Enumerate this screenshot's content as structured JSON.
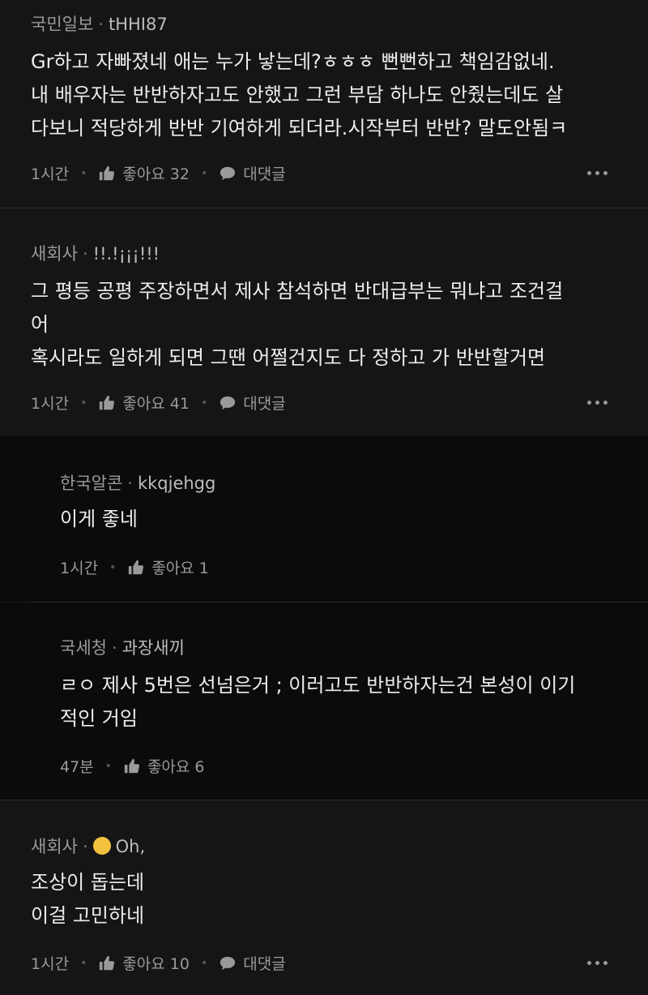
{
  "comments": [
    {
      "site": "국민일보",
      "nick": "tHHI87",
      "lines": [
        "Gr하고 자빠졌네 애는 누가 낳는데?ㅎㅎㅎ 뻔뻔하고 책임감없네.",
        "내 배우자는 반반하자고도 안했고 그런 부담 하나도 안줬는데도 살",
        "다보니 적당하게 반반 기여하게 되더라.시작부터 반반? 말도안됨ㅋ"
      ],
      "time": "1시간",
      "like": "좋아요 32",
      "reply": "대댓글"
    },
    {
      "site": "새회사",
      "nick": "!!.!¡¡¡!!!",
      "lines": [
        "그 평등 공평 주장하면서 제사 참석하면 반대급부는 뭐냐고 조건걸",
        "어",
        "혹시라도 일하게 되면 그땐 어쩔건지도 다 정하고 가 반반할거면"
      ],
      "time": "1시간",
      "like": "좋아요 41",
      "reply": "대댓글"
    },
    {
      "site": "한국알콘",
      "nick": "kkqjehgg",
      "lines": [
        "이게 좋네"
      ],
      "time": "1시간",
      "like": "좋아요 1"
    },
    {
      "site": "국세청",
      "nick": "과장새끼",
      "lines": [
        "ㄹㅇ 제사 5번은 선넘은거 ; 이러고도 반반하자는건 본성이 이기",
        "적인 거임"
      ],
      "time": "47분",
      "like": "좋아요 6"
    },
    {
      "site": "새회사",
      "nick": "Oh,",
      "badge_color": "#f3c23d",
      "lines": [
        "조상이 돕는데",
        "이걸 고민하네"
      ],
      "time": "1시간",
      "like": "좋아요 10",
      "reply": "대댓글"
    }
  ]
}
